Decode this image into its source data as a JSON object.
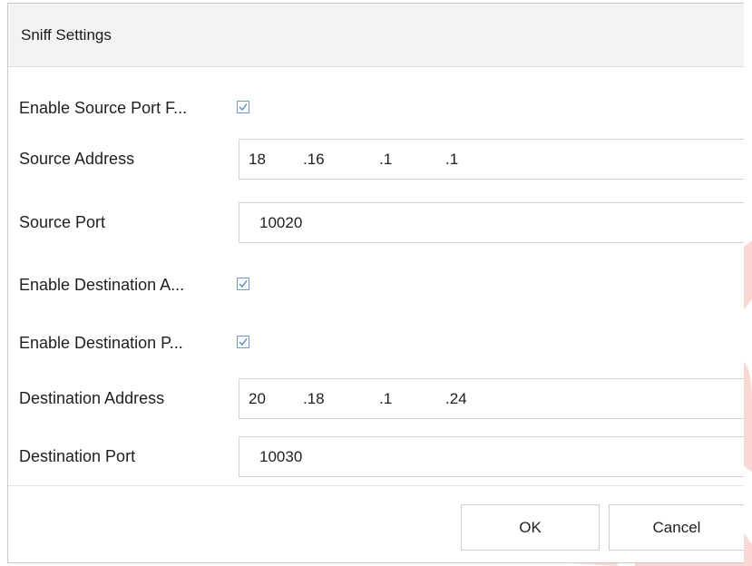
{
  "dialog": {
    "title": "Sniff Settings"
  },
  "fields": {
    "enable_source_port": {
      "label": "Enable Source Port F...",
      "checked": true
    },
    "source_address": {
      "label": "Source Address",
      "octets": [
        "18",
        ".16",
        ".1",
        ".1"
      ]
    },
    "source_port": {
      "label": "Source Port",
      "value": "10020"
    },
    "enable_destination_address": {
      "label": "Enable Destination A...",
      "checked": true
    },
    "enable_destination_port": {
      "label": "Enable Destination P...",
      "checked": true
    },
    "destination_address": {
      "label": "Destination Address",
      "octets": [
        "20",
        ".18",
        ".1",
        ".24"
      ]
    },
    "destination_port": {
      "label": "Destination Port",
      "value": "10030"
    }
  },
  "buttons": {
    "ok": "OK",
    "cancel": "Cancel"
  },
  "colors": {
    "checkbox_border": "#6b9bd1",
    "checkmark": "#4a86c8",
    "watermark": "#e8201e"
  }
}
